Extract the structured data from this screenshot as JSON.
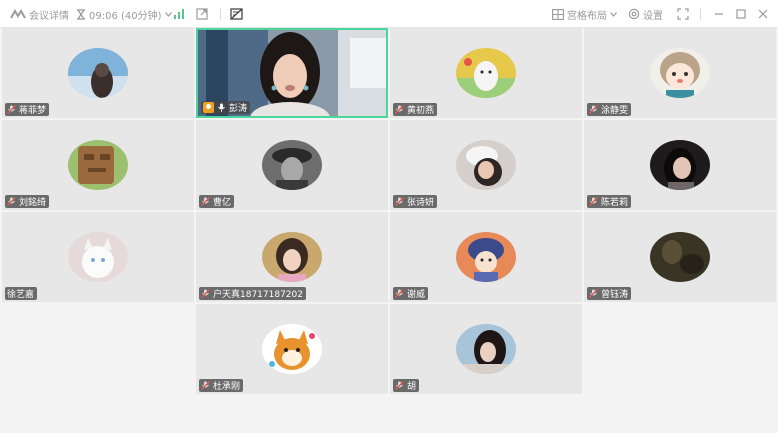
{
  "toolbar": {
    "meeting_details_label": "会议详情",
    "timer_label": "09:06 (40分钟)",
    "layout_label": "宫格布局",
    "settings_label": "设置"
  },
  "participants": [
    {
      "name": "蒋菲梦"
    },
    {
      "name": "彭涛"
    },
    {
      "name": "黄初燕"
    },
    {
      "name": "涂静雯"
    },
    {
      "name": "刘銘绮"
    },
    {
      "name": "曹亿"
    },
    {
      "name": "张诗妍"
    },
    {
      "name": "陈若莉"
    },
    {
      "name": "徐艺嘉"
    },
    {
      "name": "户天真18717187202"
    },
    {
      "name": "谢威"
    },
    {
      "name": "曾钰涛"
    },
    {
      "name": "杜承刚"
    },
    {
      "name": "胡"
    }
  ],
  "colors": {
    "active_speaker_border": "#4cd49a",
    "host_badge": "#f0a020",
    "mic_muted": "#e05a4e"
  }
}
